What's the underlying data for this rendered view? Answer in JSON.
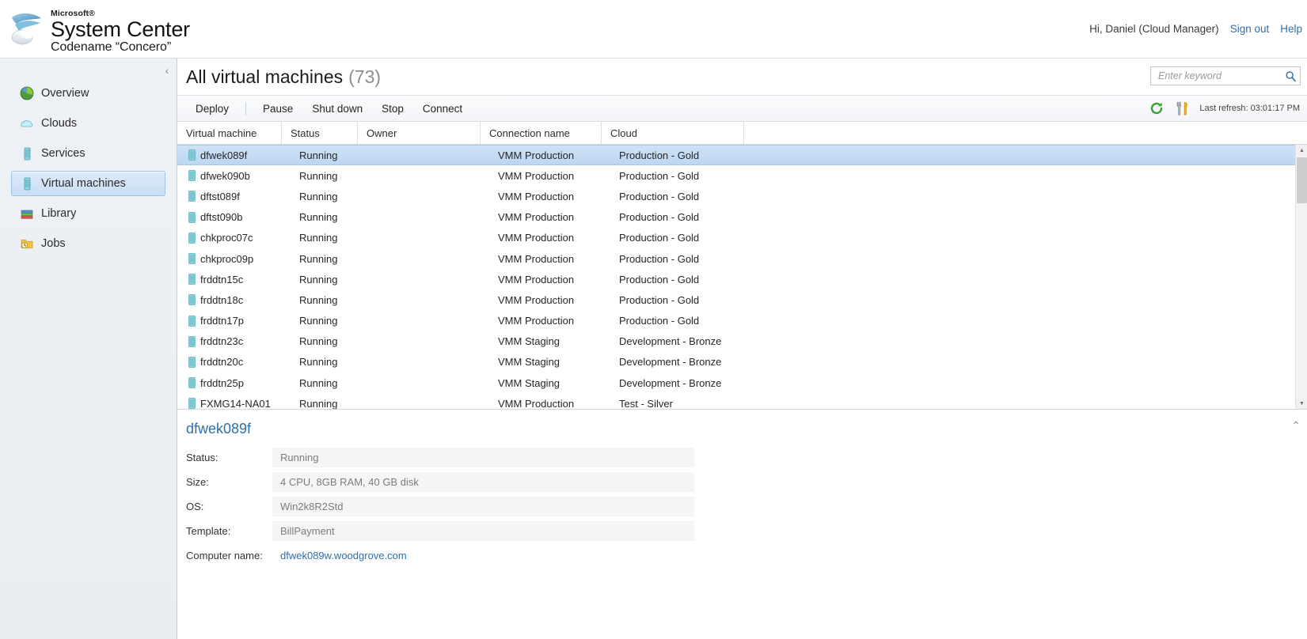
{
  "header": {
    "brand_microsoft": "Microsoft®",
    "brand_product": "System Center",
    "brand_codename": "Codename “Concero”",
    "greeting": "Hi, Daniel (Cloud Manager)",
    "sign_out": "Sign out",
    "help": "Help"
  },
  "sidebar": {
    "collapse_glyph": "‹",
    "items": [
      {
        "label": "Overview",
        "icon": "overview-pie-icon",
        "selected": false
      },
      {
        "label": "Clouds",
        "icon": "cloud-icon",
        "selected": false
      },
      {
        "label": "Services",
        "icon": "services-server-icon",
        "selected": false
      },
      {
        "label": "Virtual machines",
        "icon": "virtual-machine-icon",
        "selected": true
      },
      {
        "label": "Library",
        "icon": "library-books-icon",
        "selected": false
      },
      {
        "label": "Jobs",
        "icon": "jobs-folder-clock-icon",
        "selected": false
      }
    ]
  },
  "page": {
    "title": "All virtual machines",
    "count": "(73)"
  },
  "search": {
    "placeholder": "Enter keyword",
    "value": "",
    "icon": "search-icon"
  },
  "toolbar": {
    "deploy": "Deploy",
    "pause": "Pause",
    "shut_down": "Shut down",
    "stop": "Stop",
    "connect": "Connect",
    "refresh_icon": "refresh-icon",
    "settings_icon": "tools-icon",
    "last_refresh": "Last refresh: 03:01:17 PM"
  },
  "grid": {
    "columns": [
      "Virtual machine",
      "Status",
      "Owner",
      "Connection name",
      "Cloud",
      ""
    ],
    "rows": [
      {
        "name": "dfwek089f",
        "status": "Running",
        "owner": "",
        "connection": "VMM Production",
        "cloud": "Production - Gold",
        "selected": true
      },
      {
        "name": "dfwek090b",
        "status": "Running",
        "owner": "",
        "connection": "VMM Production",
        "cloud": "Production - Gold",
        "selected": false
      },
      {
        "name": "dftst089f",
        "status": "Running",
        "owner": "",
        "connection": "VMM Production",
        "cloud": "Production - Gold",
        "selected": false
      },
      {
        "name": "dftst090b",
        "status": "Running",
        "owner": "",
        "connection": "VMM Production",
        "cloud": "Production - Gold",
        "selected": false
      },
      {
        "name": "chkproc07c",
        "status": "Running",
        "owner": "",
        "connection": "VMM Production",
        "cloud": "Production - Gold",
        "selected": false
      },
      {
        "name": "chkproc09p",
        "status": "Running",
        "owner": "",
        "connection": "VMM Production",
        "cloud": "Production - Gold",
        "selected": false
      },
      {
        "name": "frddtn15c",
        "status": "Running",
        "owner": "",
        "connection": "VMM Production",
        "cloud": "Production - Gold",
        "selected": false
      },
      {
        "name": "frddtn18c",
        "status": "Running",
        "owner": "",
        "connection": "VMM Production",
        "cloud": "Production - Gold",
        "selected": false
      },
      {
        "name": "frddtn17p",
        "status": "Running",
        "owner": "",
        "connection": "VMM Production",
        "cloud": "Production - Gold",
        "selected": false
      },
      {
        "name": "frddtn23c",
        "status": "Running",
        "owner": "",
        "connection": "VMM Staging",
        "cloud": "Development - Bronze",
        "selected": false
      },
      {
        "name": "frddtn20c",
        "status": "Running",
        "owner": "",
        "connection": "VMM Staging",
        "cloud": "Development - Bronze",
        "selected": false
      },
      {
        "name": "frddtn25p",
        "status": "Running",
        "owner": "",
        "connection": "VMM Staging",
        "cloud": "Development - Bronze",
        "selected": false
      },
      {
        "name": "FXMG14-NA01",
        "status": "Running",
        "owner": "",
        "connection": "VMM Production",
        "cloud": "Test - Silver",
        "selected": false
      }
    ]
  },
  "details": {
    "title": "dfwek089f",
    "collapse_glyph": "⌃",
    "fields": [
      {
        "label": "Status:",
        "value": "Running",
        "link": false
      },
      {
        "label": "Size:",
        "value": "4 CPU, 8GB RAM, 40 GB disk",
        "link": false
      },
      {
        "label": "OS:",
        "value": "Win2k8R2Std",
        "link": false
      },
      {
        "label": "Template:",
        "value": "BillPayment",
        "link": false
      },
      {
        "label": "Computer name:",
        "value": "dfwek089w.woodgrove.com",
        "link": true
      }
    ]
  },
  "colors": {
    "accent_link": "#2f6faa",
    "selection": "#c3dbf3",
    "vm_icon": "#5fb8c4",
    "refresh_green": "#3a9e35"
  }
}
